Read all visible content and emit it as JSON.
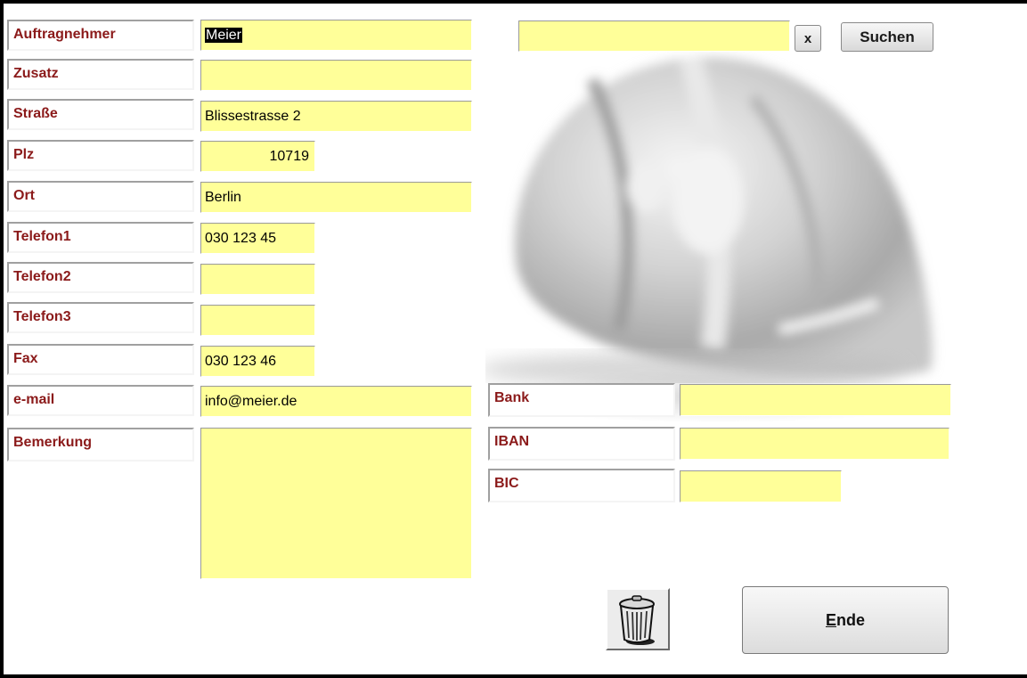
{
  "form": {
    "labels": {
      "auftragnehmer": "Auftragnehmer",
      "zusatz": "Zusatz",
      "strasse": "Straße",
      "plz": "Plz",
      "ort": "Ort",
      "telefon1": "Telefon1",
      "telefon2": "Telefon2",
      "telefon3": "Telefon3",
      "fax": "Fax",
      "email": "e-mail",
      "bemerkung": "Bemerkung",
      "bank": "Bank",
      "iban": "IBAN",
      "bic": "BIC"
    },
    "values": {
      "auftragnehmer": "Meier",
      "zusatz": "",
      "strasse": "Blissestrasse 2",
      "plz": "10719",
      "ort": "Berlin",
      "telefon1": "030 123 45",
      "telefon2": "",
      "telefon3": "",
      "fax": "030 123 46",
      "email": "info@meier.de",
      "bemerkung": "",
      "bank": "",
      "iban": "",
      "bic": "",
      "search": ""
    }
  },
  "search": {
    "clear_label": "x",
    "search_label": "Suchen"
  },
  "buttons": {
    "ende_mnemonic": "E",
    "ende_rest": "nde",
    "delete_icon": "trash-icon"
  },
  "colors": {
    "label_text": "#8b1a1a",
    "field_bg": "#ffff99"
  }
}
